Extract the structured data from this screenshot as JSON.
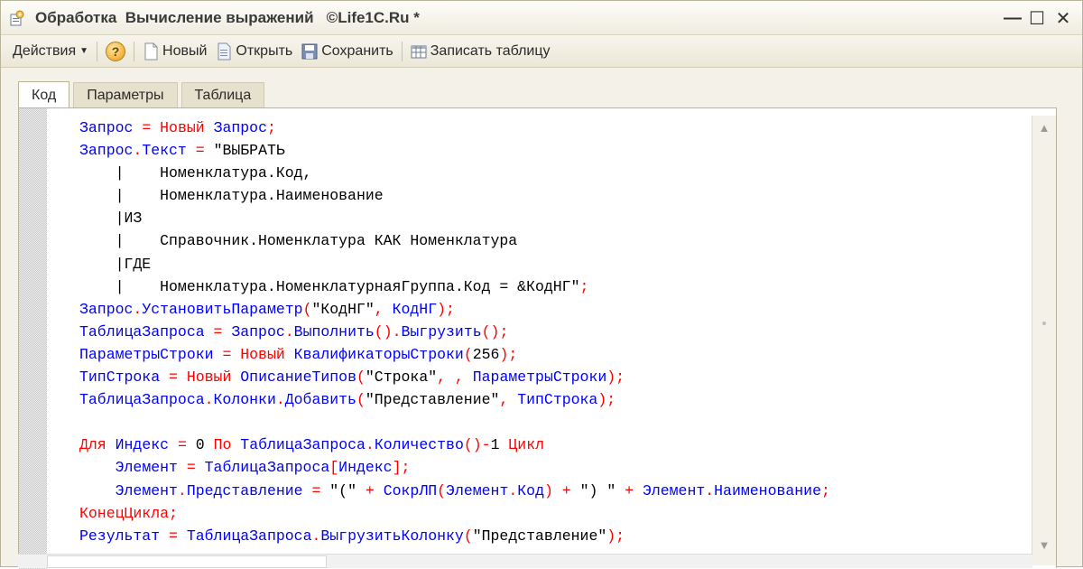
{
  "window": {
    "title": "Обработка  Вычисление выражений   ©Life1C.Ru *",
    "minimize": "—",
    "maximize": "☐",
    "close": "✕"
  },
  "toolbar": {
    "actions_label": "Действия",
    "help_label": "?",
    "new_label": "Новый",
    "open_label": "Открыть",
    "save_label": "Сохранить",
    "write_table_label": "Записать таблицу"
  },
  "tabs": [
    "Код",
    "Параметры",
    "Таблица"
  ],
  "active_tab": "Код",
  "colors": {
    "keyword": "#ff0000",
    "identifier": "#0000ff",
    "string": "#000000"
  },
  "code_lines": [
    [
      [
        "Запрос",
        "id"
      ],
      [
        " ",
        "id"
      ],
      [
        "=",
        "op"
      ],
      [
        " ",
        "id"
      ],
      [
        "Новый",
        "kw"
      ],
      [
        " ",
        "id"
      ],
      [
        "Запрос",
        "id"
      ],
      [
        ";",
        "op"
      ]
    ],
    [
      [
        "Запрос",
        "id"
      ],
      [
        ".",
        "op"
      ],
      [
        "Текст",
        "id"
      ],
      [
        " ",
        "id"
      ],
      [
        "=",
        "op"
      ],
      [
        " ",
        "id"
      ],
      [
        "\"ВЫБРАТЬ",
        "str"
      ]
    ],
    [
      [
        "    |    Номенклатура.Код,",
        "str"
      ]
    ],
    [
      [
        "    |    Номенклатура.Наименование",
        "str"
      ]
    ],
    [
      [
        "    |ИЗ",
        "str"
      ]
    ],
    [
      [
        "    |    Справочник.Номенклатура КАК Номенклатура",
        "str"
      ]
    ],
    [
      [
        "    |ГДЕ",
        "str"
      ]
    ],
    [
      [
        "    |    Номенклатура.НоменклатурнаяГруппа.Код = &КодНГ\"",
        "str"
      ],
      [
        ";",
        "op"
      ]
    ],
    [
      [
        "Запрос",
        "id"
      ],
      [
        ".",
        "op"
      ],
      [
        "УстановитьПараметр",
        "id"
      ],
      [
        "(",
        "op"
      ],
      [
        "\"КодНГ\"",
        "str"
      ],
      [
        ", ",
        "op"
      ],
      [
        "КодНГ",
        "id"
      ],
      [
        ");",
        "op"
      ]
    ],
    [
      [
        "ТаблицаЗапроса",
        "id"
      ],
      [
        " ",
        "id"
      ],
      [
        "=",
        "op"
      ],
      [
        " ",
        "id"
      ],
      [
        "Запрос",
        "id"
      ],
      [
        ".",
        "op"
      ],
      [
        "Выполнить",
        "id"
      ],
      [
        "().",
        "op"
      ],
      [
        "Выгрузить",
        "id"
      ],
      [
        "();",
        "op"
      ]
    ],
    [
      [
        "ПараметрыСтроки",
        "id"
      ],
      [
        " ",
        "id"
      ],
      [
        "=",
        "op"
      ],
      [
        " ",
        "id"
      ],
      [
        "Новый",
        "kw"
      ],
      [
        " ",
        "id"
      ],
      [
        "КвалификаторыСтроки",
        "id"
      ],
      [
        "(",
        "op"
      ],
      [
        "256",
        "num"
      ],
      [
        ");",
        "op"
      ]
    ],
    [
      [
        "ТипСтрока",
        "id"
      ],
      [
        " ",
        "id"
      ],
      [
        "=",
        "op"
      ],
      [
        " ",
        "id"
      ],
      [
        "Новый",
        "kw"
      ],
      [
        " ",
        "id"
      ],
      [
        "ОписаниеТипов",
        "id"
      ],
      [
        "(",
        "op"
      ],
      [
        "\"Строка\"",
        "str"
      ],
      [
        ", , ",
        "op"
      ],
      [
        "ПараметрыСтроки",
        "id"
      ],
      [
        ");",
        "op"
      ]
    ],
    [
      [
        "ТаблицаЗапроса",
        "id"
      ],
      [
        ".",
        "op"
      ],
      [
        "Колонки",
        "id"
      ],
      [
        ".",
        "op"
      ],
      [
        "Добавить",
        "id"
      ],
      [
        "(",
        "op"
      ],
      [
        "\"Представление\"",
        "str"
      ],
      [
        ", ",
        "op"
      ],
      [
        "ТипСтрока",
        "id"
      ],
      [
        ");",
        "op"
      ]
    ],
    [],
    [
      [
        "Для",
        "kw"
      ],
      [
        " ",
        "id"
      ],
      [
        "Индекс",
        "id"
      ],
      [
        " ",
        "id"
      ],
      [
        "=",
        "op"
      ],
      [
        " ",
        "id"
      ],
      [
        "0",
        "num"
      ],
      [
        " ",
        "id"
      ],
      [
        "По",
        "kw"
      ],
      [
        " ",
        "id"
      ],
      [
        "ТаблицаЗапроса",
        "id"
      ],
      [
        ".",
        "op"
      ],
      [
        "Количество",
        "id"
      ],
      [
        "()-",
        "op"
      ],
      [
        "1",
        "num"
      ],
      [
        " ",
        "id"
      ],
      [
        "Цикл",
        "kw"
      ]
    ],
    [
      [
        "    ",
        "id"
      ],
      [
        "Элемент",
        "id"
      ],
      [
        " ",
        "id"
      ],
      [
        "=",
        "op"
      ],
      [
        " ",
        "id"
      ],
      [
        "ТаблицаЗапроса",
        "id"
      ],
      [
        "[",
        "op"
      ],
      [
        "Индекс",
        "id"
      ],
      [
        "];",
        "op"
      ]
    ],
    [
      [
        "    ",
        "id"
      ],
      [
        "Элемент",
        "id"
      ],
      [
        ".",
        "op"
      ],
      [
        "Представление",
        "id"
      ],
      [
        " ",
        "id"
      ],
      [
        "=",
        "op"
      ],
      [
        " ",
        "id"
      ],
      [
        "\"(\"",
        "str"
      ],
      [
        " ",
        "id"
      ],
      [
        "+",
        "op"
      ],
      [
        " ",
        "id"
      ],
      [
        "СокрЛП",
        "id"
      ],
      [
        "(",
        "op"
      ],
      [
        "Элемент",
        "id"
      ],
      [
        ".",
        "op"
      ],
      [
        "Код",
        "id"
      ],
      [
        ")",
        "op"
      ],
      [
        " ",
        "id"
      ],
      [
        "+",
        "op"
      ],
      [
        " ",
        "id"
      ],
      [
        "\") \"",
        "str"
      ],
      [
        " ",
        "id"
      ],
      [
        "+",
        "op"
      ],
      [
        " ",
        "id"
      ],
      [
        "Элемент",
        "id"
      ],
      [
        ".",
        "op"
      ],
      [
        "Наименование",
        "id"
      ],
      [
        ";",
        "op"
      ]
    ],
    [
      [
        "КонецЦикла",
        "kw"
      ],
      [
        ";",
        "op"
      ]
    ],
    [
      [
        "Результат",
        "id"
      ],
      [
        " ",
        "id"
      ],
      [
        "=",
        "op"
      ],
      [
        " ",
        "id"
      ],
      [
        "ТаблицаЗапроса",
        "id"
      ],
      [
        ".",
        "op"
      ],
      [
        "ВыгрузитьКолонку",
        "id"
      ],
      [
        "(",
        "op"
      ],
      [
        "\"Представление\"",
        "str"
      ],
      [
        ");",
        "op"
      ]
    ]
  ]
}
